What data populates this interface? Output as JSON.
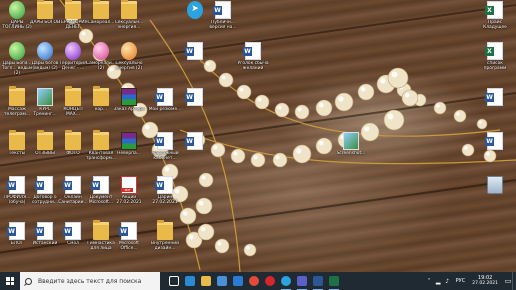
{
  "desktop": {
    "icons": [
      {
        "label": "ДАРЫ ТОГЛИНЬ (2)",
        "kind": "orb-green"
      },
      {
        "label": "ДАРЫ БОГОВ",
        "kind": "folder"
      },
      {
        "label": "ТЕРРИТОРИЯ ДЕНЕГ",
        "kind": "folder"
      },
      {
        "label": "Самореал...",
        "kind": "folder"
      },
      {
        "label": "Сексуальн... энергия...",
        "kind": "folder"
      },
      {
        "label": "",
        "kind": "telegram"
      },
      {
        "label": "Публичн... версия на...",
        "kind": "doc"
      },
      {
        "label": "Прайс Кладущее",
        "kind": "xls"
      },
      {
        "label": "Дары Боги... Тогл... ведьм (2)",
        "kind": "orb-green"
      },
      {
        "label": "Дары богов (ведьм) (2)",
        "kind": "orb-blue"
      },
      {
        "label": "Территория Денег - ...",
        "kind": "orb-purple"
      },
      {
        "label": "Самореали... (2)",
        "kind": "orb-pink"
      },
      {
        "label": "Сексуально энергия (2)",
        "kind": "orb-orange"
      },
      {
        "label": "",
        "kind": "doc"
      },
      {
        "label": "Уголок сбыча желаний",
        "kind": "doc"
      },
      {
        "label": "список программ",
        "kind": "xls"
      },
      {
        "label": "Массаж телеграм...",
        "kind": "folder"
      },
      {
        "label": "КУРС Тренинг...",
        "kind": "pic"
      },
      {
        "label": "КОНЦЕП МАХ...",
        "kind": "folder"
      },
      {
        "label": "кор...",
        "kind": "folder"
      },
      {
        "label": "Заказ Артера",
        "kind": "rar"
      },
      {
        "label": "Мои резюме...",
        "kind": "doc"
      },
      {
        "label": "",
        "kind": "doc"
      },
      {
        "label": "",
        "kind": "doc"
      },
      {
        "label": "Тексты",
        "kind": "folder"
      },
      {
        "label": "ОТЗЫВЫ",
        "kind": "folder"
      },
      {
        "label": "ФОТО",
        "kind": "folder"
      },
      {
        "label": "Квантовая трансформ...",
        "kind": "folder"
      },
      {
        "label": "Неверпа...",
        "kind": "rar"
      },
      {
        "label": "Массажный кабинет...",
        "kind": "doc"
      },
      {
        "label": "",
        "kind": "doc"
      },
      {
        "label": "Screenshot...",
        "kind": "pic"
      },
      {
        "label": "",
        "kind": "doc"
      },
      {
        "label": "ПРОФИЛЯ...(обуча)",
        "kind": "doc"
      },
      {
        "label": "Договор о сотрудни...",
        "kind": "doc"
      },
      {
        "label": "Онлайн Санитарии...",
        "kind": "doc"
      },
      {
        "label": "Документ Microsoft...",
        "kind": "doc"
      },
      {
        "label": "Акции 27.02.2021",
        "kind": "pdf"
      },
      {
        "label": "Дарин 27.02.2021",
        "kind": "doc"
      },
      {
        "label": "",
        "kind": "bin"
      },
      {
        "label": "БЛОГ",
        "kind": "doc"
      },
      {
        "label": "Истанский",
        "kind": "doc"
      },
      {
        "label": "Смол",
        "kind": "doc"
      },
      {
        "label": "Гимнастика для лица",
        "kind": "folder"
      },
      {
        "label": "Microsoft Office...",
        "kind": "doc"
      },
      {
        "label": "Внутренний дизайн...",
        "kind": "folder"
      }
    ]
  },
  "taskbar": {
    "search_placeholder": "Введите здесь текст для поиска",
    "pinned": [
      {
        "name": "task-view",
        "color": "#ffffff"
      },
      {
        "name": "edge",
        "color": "#2a8ad4"
      },
      {
        "name": "explorer",
        "color": "#e9b949"
      },
      {
        "name": "store",
        "color": "#4a90d9"
      },
      {
        "name": "mail",
        "color": "#2b7bd6"
      },
      {
        "name": "chrome",
        "color": "#e24b3a"
      },
      {
        "name": "opera",
        "color": "#d8252b"
      },
      {
        "name": "telegram",
        "color": "#2aa3df"
      },
      {
        "name": "teams",
        "color": "#5b5fc7"
      },
      {
        "name": "word",
        "color": "#2b5797"
      },
      {
        "name": "excel",
        "color": "#1e7145"
      }
    ],
    "tray": {
      "lang": "РУС",
      "time": "19:02",
      "date": "27.02.2021"
    }
  }
}
